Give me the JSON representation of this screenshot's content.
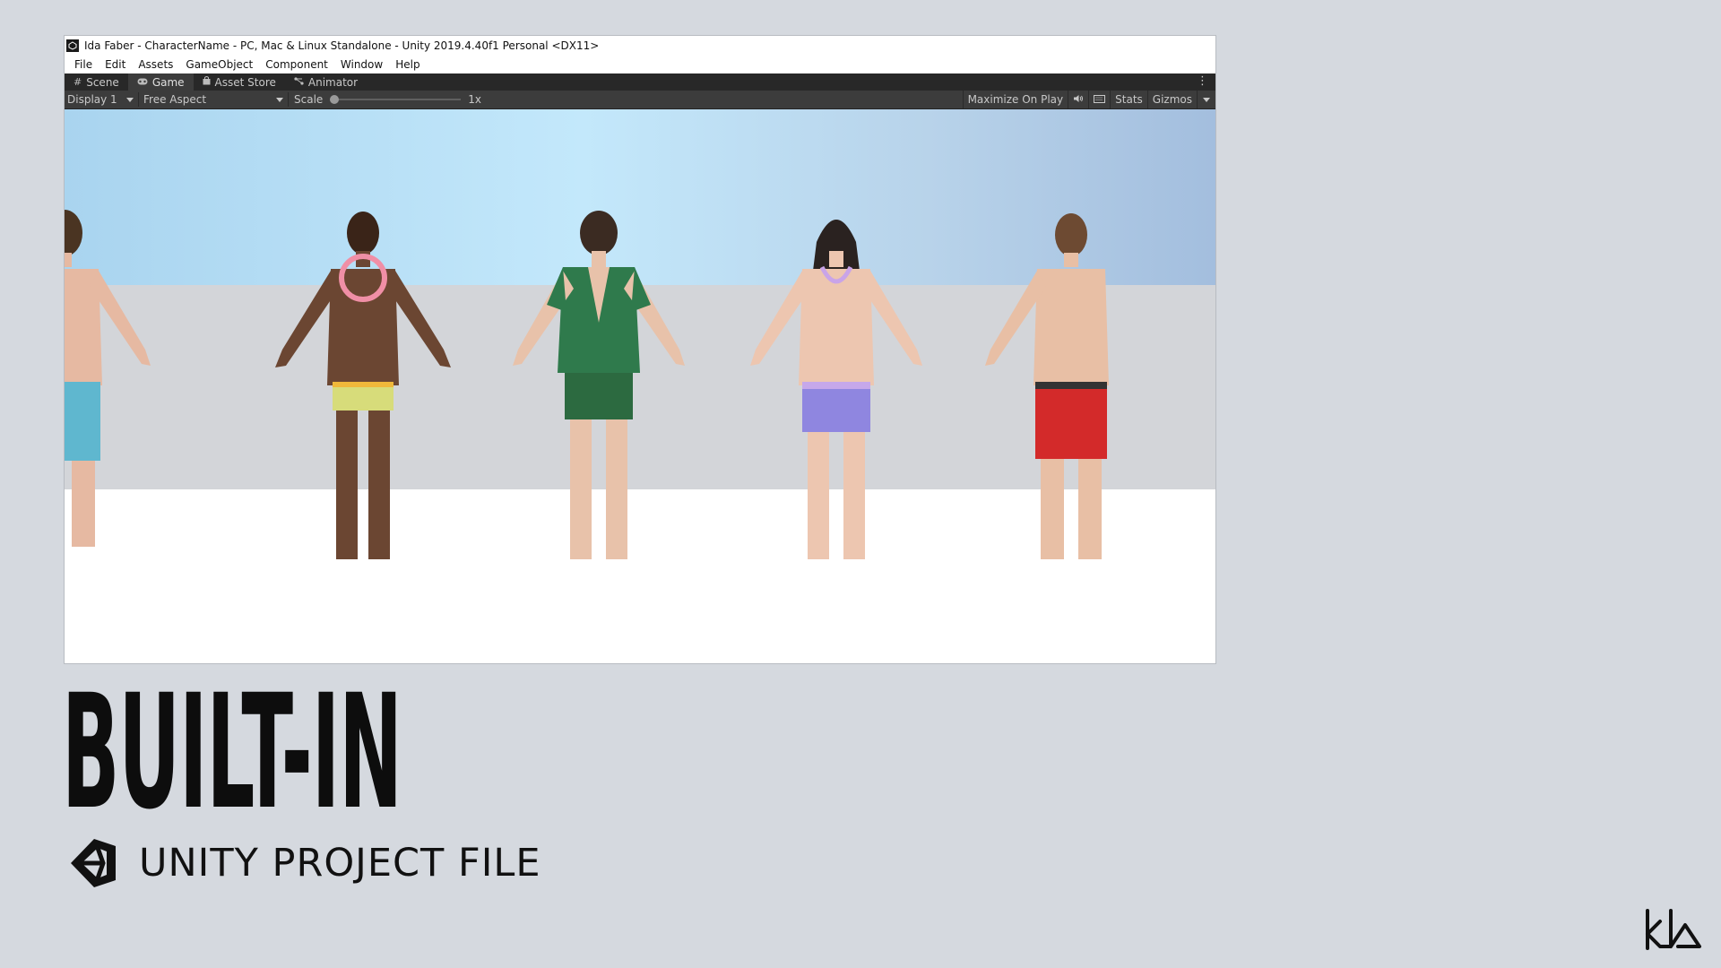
{
  "window": {
    "title": "Ida Faber - CharacterName - PC, Mac & Linux Standalone - Unity 2019.4.40f1 Personal <DX11>"
  },
  "menu": [
    "File",
    "Edit",
    "Assets",
    "GameObject",
    "Component",
    "Window",
    "Help"
  ],
  "tabs": [
    {
      "label": "Scene",
      "icon": "grid-icon"
    },
    {
      "label": "Game",
      "icon": "gamepad-icon"
    },
    {
      "label": "Asset Store",
      "icon": "bag-icon"
    },
    {
      "label": "Animator",
      "icon": "animator-icon"
    }
  ],
  "toolbar": {
    "display": "Display 1",
    "aspect": "Free Aspect",
    "scale_label": "Scale",
    "scale_value": "1x",
    "maximize": "Maximize On Play",
    "stats": "Stats",
    "gizmos": "Gizmos"
  },
  "heading": "BUILT-IN",
  "subheading": "UNITY PROJECT FILE",
  "colors": {
    "background": "#d5d9df",
    "tabbar": "#282828",
    "toolbar": "#3c3c3c"
  }
}
